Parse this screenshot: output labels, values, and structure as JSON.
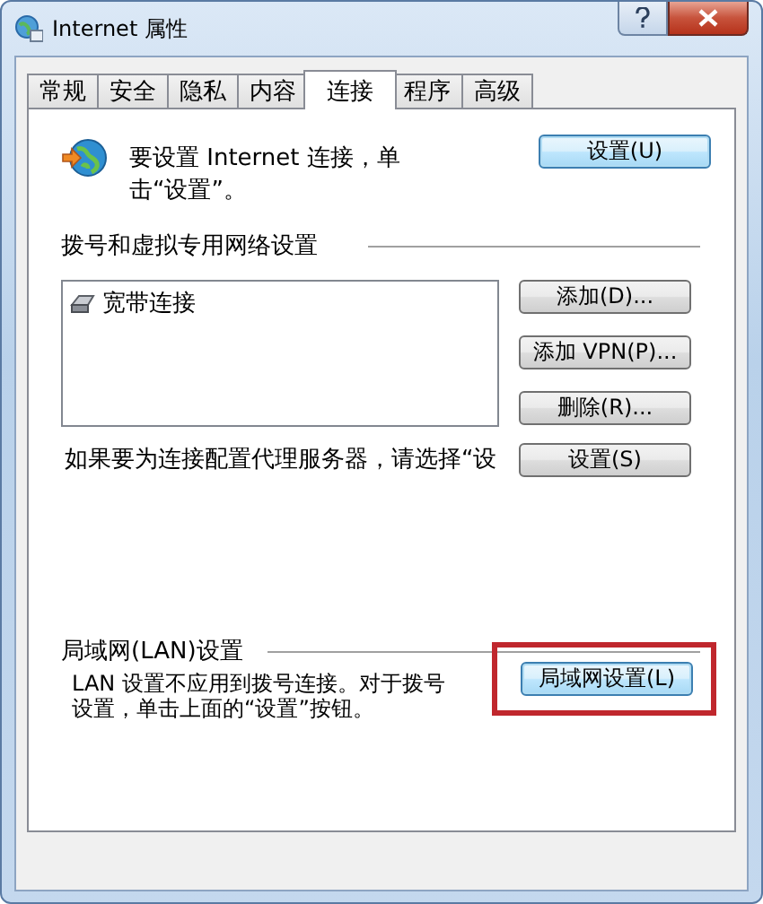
{
  "window": {
    "title": "Internet 属性"
  },
  "tabs": [
    {
      "label": "常规",
      "selected": false
    },
    {
      "label": "安全",
      "selected": false
    },
    {
      "label": "隐私",
      "selected": false
    },
    {
      "label": "内容",
      "selected": false
    },
    {
      "label": "连接",
      "selected": true
    },
    {
      "label": "程序",
      "selected": false
    },
    {
      "label": "高级",
      "selected": false
    }
  ],
  "setup": {
    "text": "要设置 Internet 连接，单击“设置”。",
    "button": "设置(U)"
  },
  "dialup": {
    "heading": "拨号和虚拟专用网络设置",
    "connections": [
      "宽带连接"
    ],
    "buttons": [
      "添加(D)...",
      "添加 VPN(P)...",
      "删除(R)..."
    ],
    "proxy_text": "如果要为连接配置代理服务器，请选择“设",
    "proxy_button": "设置(S)"
  },
  "lan": {
    "heading": "局域网(LAN)设置",
    "text": "LAN 设置不应用到拨号连接。对于拨号设置，单击上面的“设置”按钮。",
    "button": {
      "label": "局域网设置(L)",
      "highlighted": true
    }
  }
}
